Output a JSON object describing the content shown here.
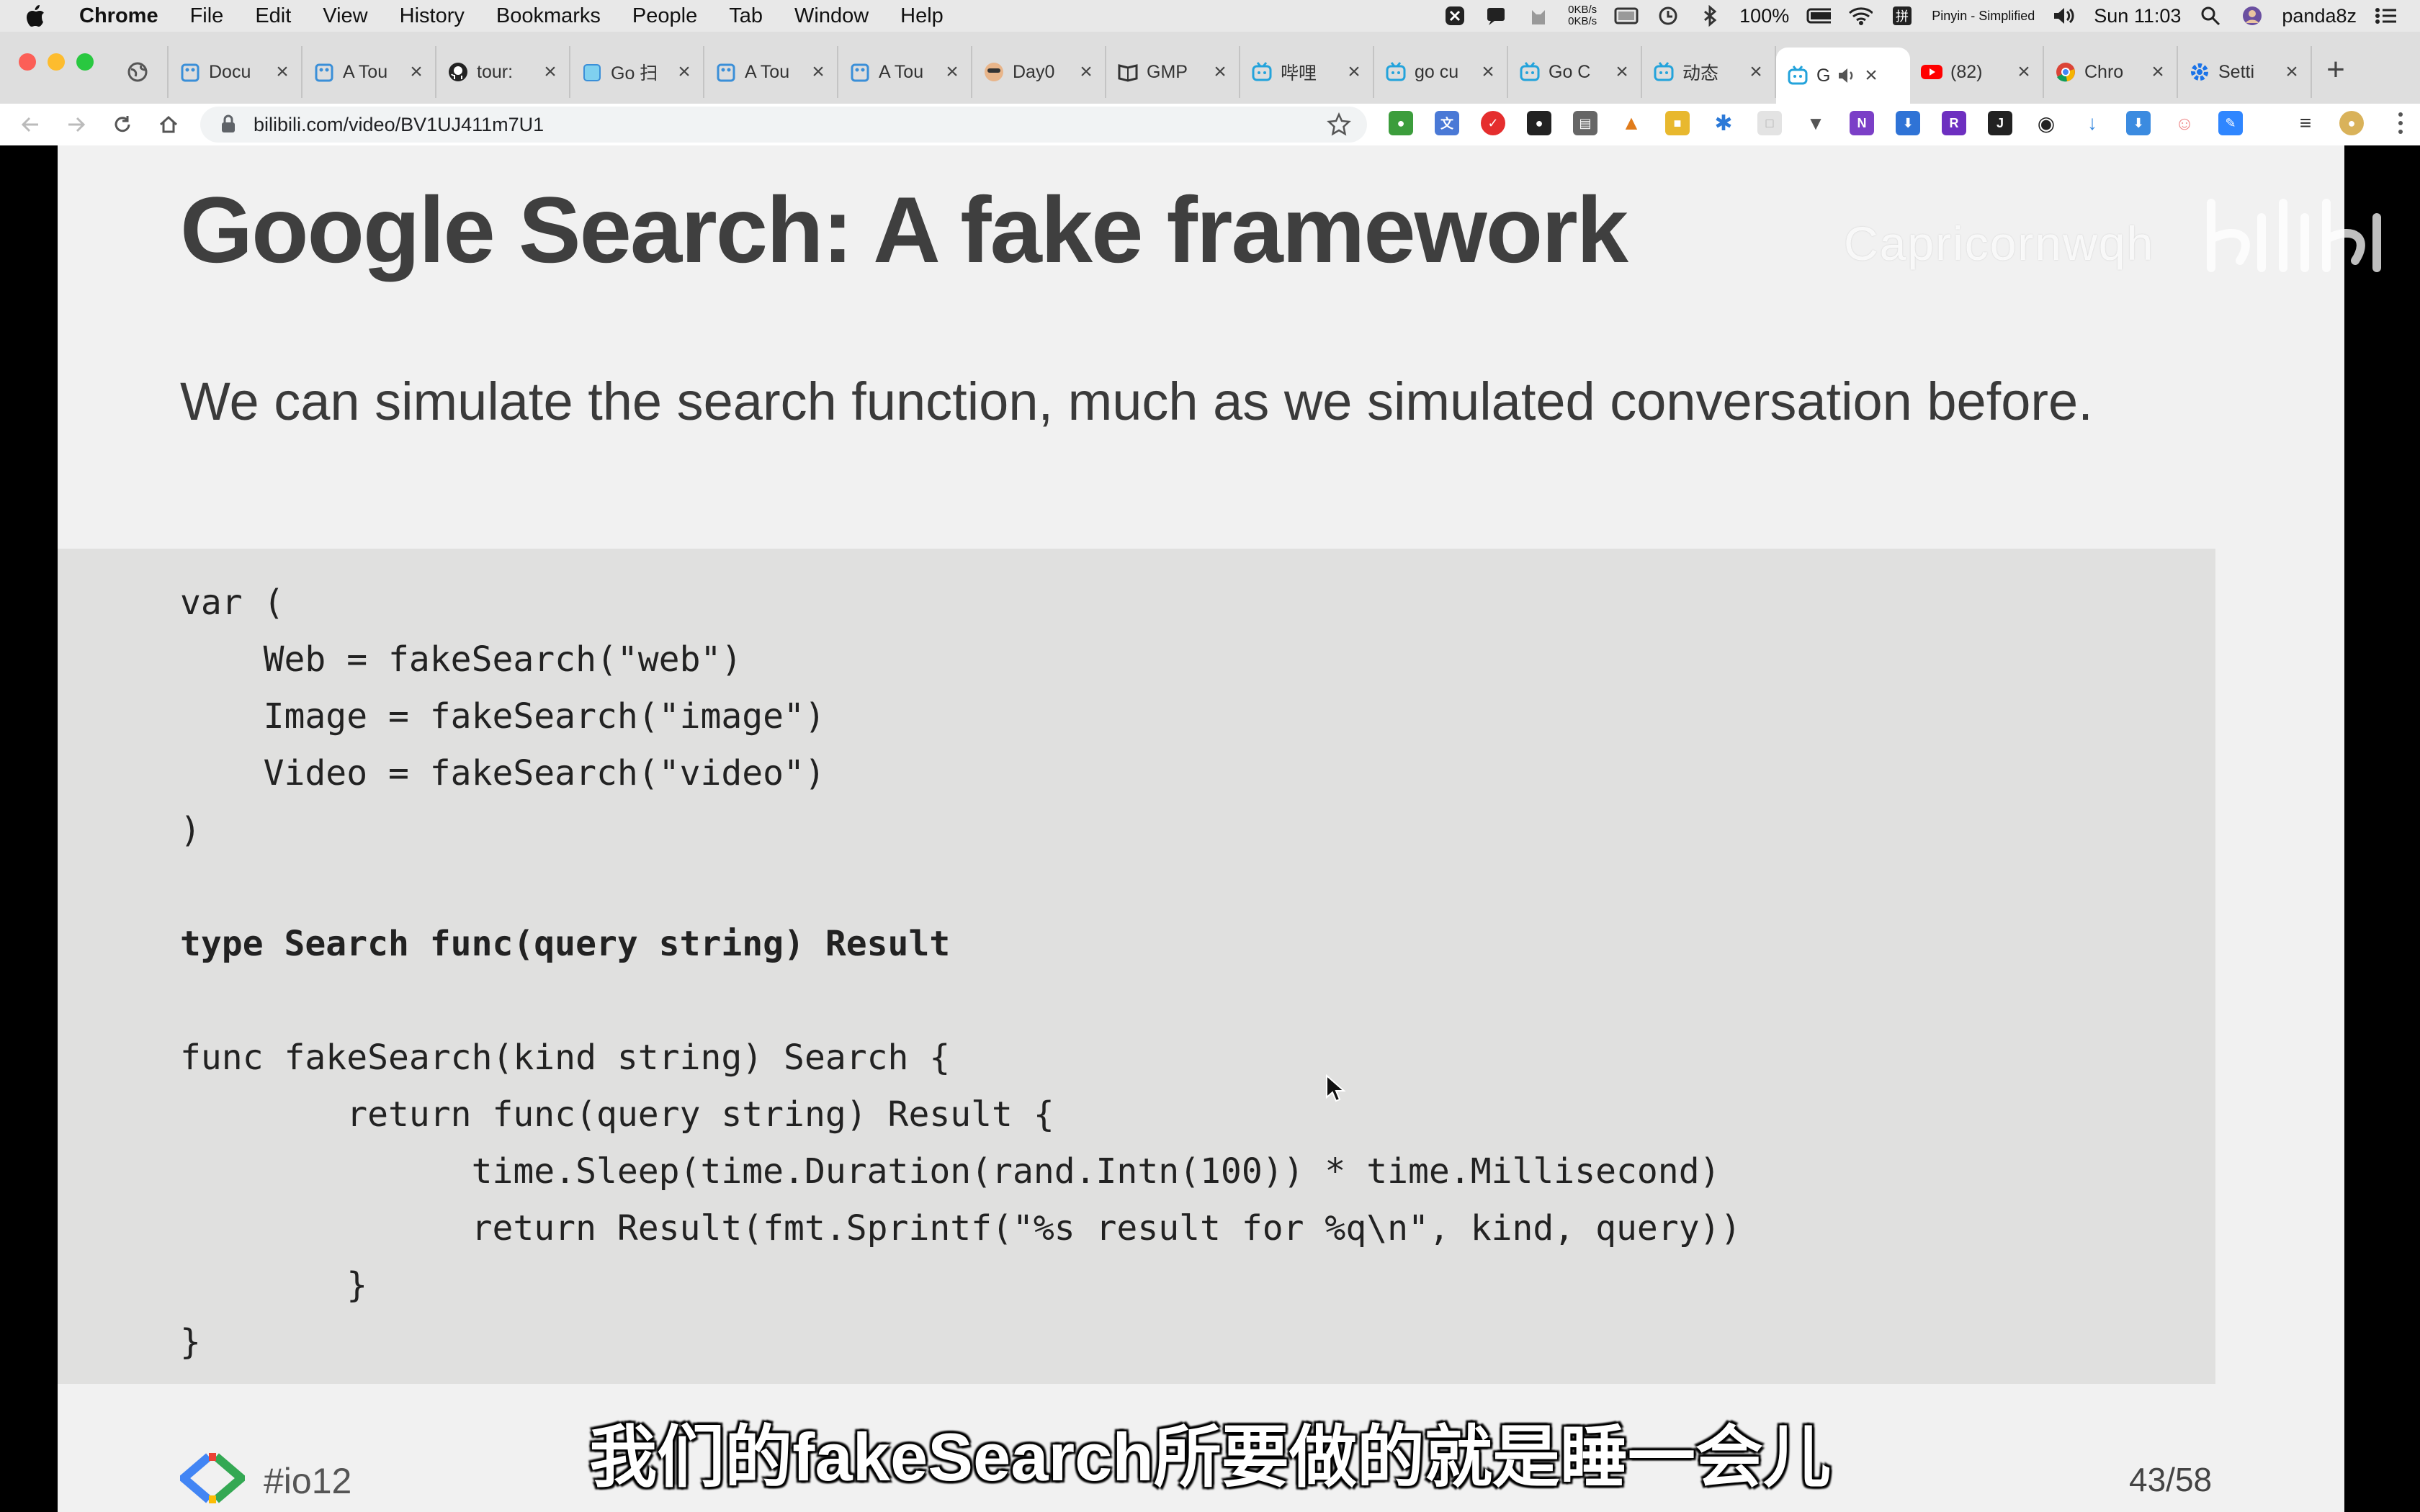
{
  "menubar": {
    "items": [
      "Chrome",
      "File",
      "Edit",
      "View",
      "History",
      "Bookmarks",
      "People",
      "Tab",
      "Window",
      "Help"
    ],
    "net_up": "0KB/s",
    "net_down": "0KB/s",
    "battery": "100%",
    "input_method": "Pinyin - Simplified",
    "clock": "Sun 11:03",
    "user": "panda8z"
  },
  "tabs": [
    {
      "title": "",
      "icon": "globe-icon",
      "pinned": true
    },
    {
      "title": "Docu",
      "icon": "go-gopher-icon"
    },
    {
      "title": "A Tou",
      "icon": "go-gopher-icon"
    },
    {
      "title": "tour:",
      "icon": "github-icon"
    },
    {
      "title": "Go 扫",
      "icon": "go-gopher-icon"
    },
    {
      "title": "A Tou",
      "icon": "go-gopher-icon"
    },
    {
      "title": "A Tou",
      "icon": "go-gopher-icon"
    },
    {
      "title": "Day0",
      "icon": "avatar-icon"
    },
    {
      "title": "GMP",
      "icon": "book-icon"
    },
    {
      "title": "哔哩",
      "icon": "bilibili-icon"
    },
    {
      "title": "go cu",
      "icon": "bilibili-icon"
    },
    {
      "title": "Go C",
      "icon": "bilibili-icon"
    },
    {
      "title": "动态",
      "icon": "bilibili-icon"
    },
    {
      "title": "G",
      "icon": "bilibili-icon",
      "active": true,
      "audio": true
    },
    {
      "title": "(82)",
      "icon": "youtube-icon"
    },
    {
      "title": "Chro",
      "icon": "chrome-icon"
    },
    {
      "title": "Setti",
      "icon": "gear-icon"
    }
  ],
  "toolbar": {
    "url": "bilibili.com/video/BV1UJ411m7U1"
  },
  "slide": {
    "title": "Google Search: A fake framework",
    "body": "We can simulate the search function, much as we simulated conversation before.",
    "code_lines": [
      "var (",
      "    Web = fakeSearch(\"web\")",
      "    Image = fakeSearch(\"image\")",
      "    Video = fakeSearch(\"video\")",
      ")",
      "",
      "type Search func(query string) Result",
      "",
      "func fakeSearch(kind string) Search {",
      "        return func(query string) Result {",
      "              time.Sleep(time.Duration(rand.Intn(100)) * time.Millisecond)",
      "              return Result(fmt.Sprintf(\"%s result for %q\\n\", kind, query))",
      "        }",
      "}"
    ],
    "hashtag": "#io12",
    "page": "43/58"
  },
  "video": {
    "watermark": "Capricornwqh",
    "subtitle": "我们的fakeSearch所要做的就是睡一会儿"
  }
}
